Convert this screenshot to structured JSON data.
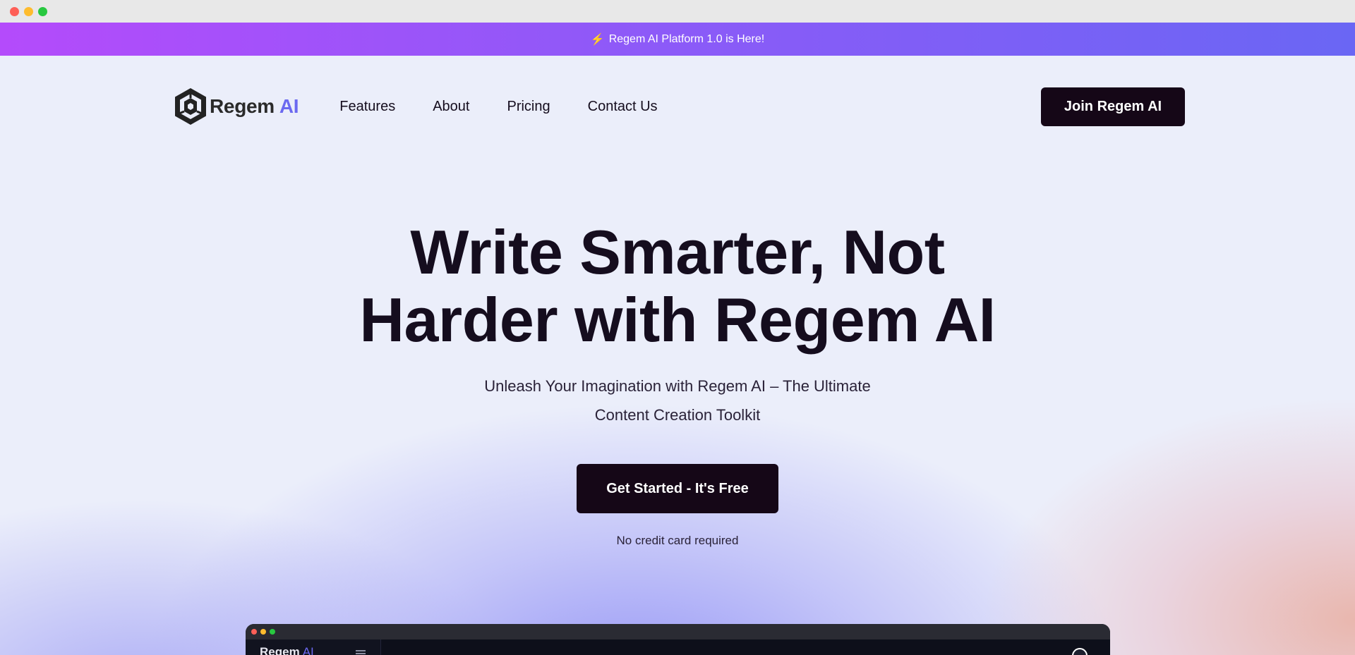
{
  "announcement": {
    "icon": "lightning-icon",
    "bolt": "⚡",
    "text": "Regem AI Platform 1.0 is Here!"
  },
  "nav": {
    "logo_name": "Regem",
    "logo_suffix": "AI",
    "links": [
      "Features",
      "About",
      "Pricing",
      "Contact Us"
    ],
    "cta_label": "Join Regem AI"
  },
  "hero": {
    "headline_line1": "Write Smarter, Not",
    "headline_line2": "Harder with Regem AI",
    "subhead_line1": "Unleash Your Imagination with Regem AI – The Ultimate",
    "subhead_line2": "Content Creation Toolkit",
    "cta_label": "Get Started - It's Free",
    "note": "No credit card required"
  },
  "preview": {
    "logo_name": "Regem",
    "logo_suffix": "AI"
  },
  "colors": {
    "accent": "#6b69f0",
    "button_dark": "#150717",
    "banner_start": "#b44bfb",
    "banner_end": "#6a66f4"
  }
}
